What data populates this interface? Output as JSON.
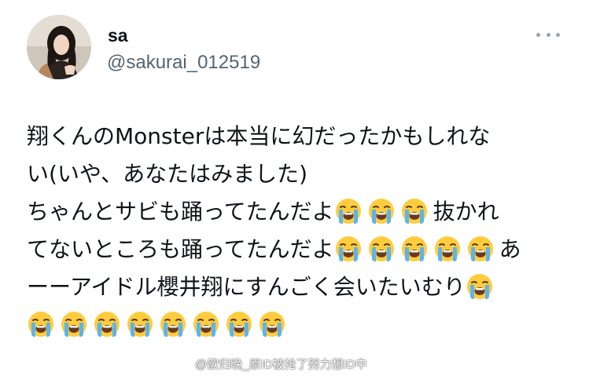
{
  "user": {
    "display_name": "sa",
    "handle": "@sakurai_012519",
    "avatar_icon": "profile-photo"
  },
  "menu": {
    "icon": "more-horizontal-icon"
  },
  "tweet": {
    "lines": [
      {
        "text": "翔くんのMonsterは本当に幻だったかもしれな",
        "emoji_after": 0
      },
      {
        "text": "い(いや、あなたはみました)",
        "emoji_after": 0
      },
      {
        "text": "ちゃんとサビも踊ってたんだよ",
        "emoji_after": 3,
        "suffix": "抜かれ"
      },
      {
        "text": "てないところも踊ってたんだよ",
        "emoji_after": 5,
        "suffix": "あ"
      },
      {
        "text": "ーーアイドル櫻井翔にすんごく会いたいむり",
        "emoji_after": 1
      },
      {
        "text": "",
        "emoji_after": 8
      }
    ],
    "emoji": "loudly-crying-face"
  },
  "watermark": {
    "text": "@歆归晚_原ID被抢了努力想ID中",
    "icon": "weibo-icon"
  },
  "colors": {
    "text": "#0f1419",
    "secondary": "#536471",
    "emoji_face": "#ffcc3e",
    "emoji_tears": "#5ab4f0"
  }
}
